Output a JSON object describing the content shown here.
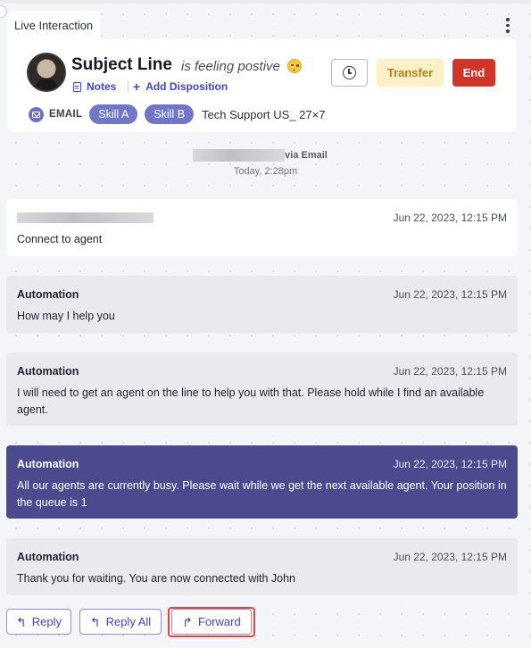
{
  "tab": {
    "label": "Live Interaction"
  },
  "header": {
    "subject": "Subject Line",
    "feeling": "is feeling postive",
    "emoji": "winking-face",
    "links": {
      "notes": "Notes",
      "add_disposition": "Add Disposition"
    },
    "buttons": {
      "transfer": "Transfer",
      "end": "End"
    },
    "channel": "EMAIL",
    "skills": [
      "Skill A",
      "Skill B"
    ],
    "queue": "Tech Support US_ 27×7",
    "colors": {
      "accent": "#4147b8",
      "end": "#cf3528",
      "transfer_bg": "#fdf0c6",
      "skill_bg": "#7276c6"
    }
  },
  "thread_intro": {
    "via": "via Email",
    "time": "Today, 2:28pm"
  },
  "messages": [
    {
      "sender": "",
      "time": "Jun 22, 2023, 12:15 PM",
      "body": "Connect to agent"
    },
    {
      "sender": "Automation",
      "time": "Jun 22, 2023, 12:15 PM",
      "body": "How may I help you"
    },
    {
      "sender": "Automation",
      "time": "Jun 22, 2023, 12:15 PM",
      "body": "I will need to get an agent on the line to help you with that. Please hold while I find an available agent."
    },
    {
      "sender": "Automation",
      "time": "Jun 22, 2023, 12:15 PM",
      "body": "All our agents are currently busy. Please wait while we get the next available agent. Your position in the queue is 1"
    },
    {
      "sender": "Automation",
      "time": "Jun 22, 2023, 12:15 PM",
      "body": "Thank you for waiting. You are now connected with John"
    }
  ],
  "actions": {
    "reply": "Reply",
    "reply_all": "Reply All",
    "forward": "Forward"
  }
}
